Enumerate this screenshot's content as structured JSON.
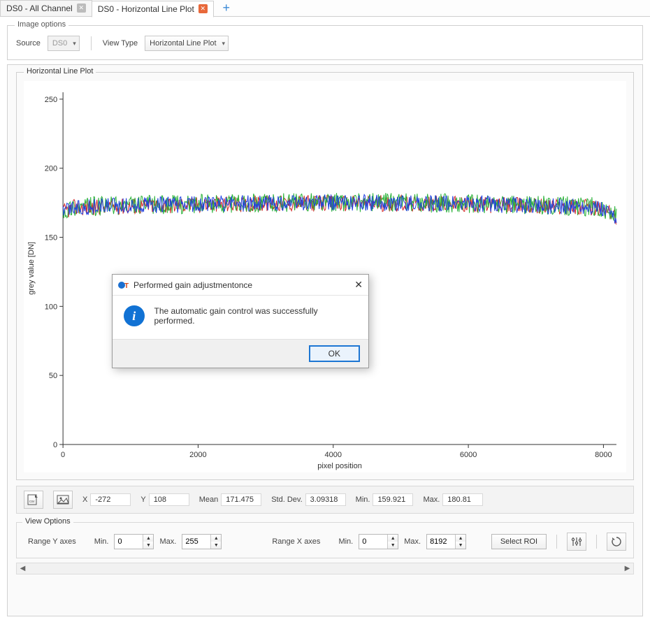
{
  "tabs": [
    {
      "label": "DS0 - All Channel",
      "active": false,
      "close_style": "grey"
    },
    {
      "label": "DS0 - Horizontal Line Plot",
      "active": true,
      "close_style": "orange"
    }
  ],
  "image_options": {
    "legend": "Image options",
    "source_label": "Source",
    "source_value": "DS0",
    "view_type_label": "View Type",
    "view_type_value": "Horizontal Line Plot"
  },
  "plot": {
    "group_title": "Horizontal Line Plot"
  },
  "chart_data": {
    "type": "line",
    "title": "",
    "xlabel": "pixel position",
    "ylabel": "grey value [DN]",
    "xlim": [
      0,
      8192
    ],
    "ylim": [
      0,
      255
    ],
    "xticks": [
      0,
      2000,
      4000,
      6000,
      8000
    ],
    "yticks": [
      0,
      50,
      100,
      150,
      200,
      250
    ],
    "series": [
      {
        "name": "red",
        "color": "#d42a2a",
        "mean": 171.2,
        "noise_amp": 6,
        "edge_drop": 6
      },
      {
        "name": "green",
        "color": "#2bb23a",
        "mean": 171.8,
        "noise_amp": 7,
        "edge_drop": 6
      },
      {
        "name": "blue",
        "color": "#1f3fe0",
        "mean": 171.5,
        "noise_amp": 6,
        "edge_drop": 6
      }
    ],
    "summary": {
      "mean": 171.475,
      "std_dev": 3.09318,
      "min": 159.921,
      "max": 180.81
    }
  },
  "status_bar": {
    "x_label": "X",
    "x_value": "-272",
    "y_label": "Y",
    "y_value": "108",
    "mean_label": "Mean",
    "mean_value": "171.475",
    "std_label": "Std. Dev.",
    "std_value": "3.09318",
    "min_label": "Min.",
    "min_value": "159.921",
    "max_label": "Max.",
    "max_value": "180.81"
  },
  "view_options": {
    "legend": "View Options",
    "range_y_label": "Range Y axes",
    "range_x_label": "Range X axes",
    "min_label": "Min.",
    "max_label": "Max.",
    "y_min": "0",
    "y_max": "255",
    "x_min": "0",
    "x_max": "8192",
    "select_roi": "Select ROI"
  },
  "dialog": {
    "title": "Performed gain adjustmentonce",
    "message": "The automatic gain control was successfully performed.",
    "ok": "OK"
  }
}
